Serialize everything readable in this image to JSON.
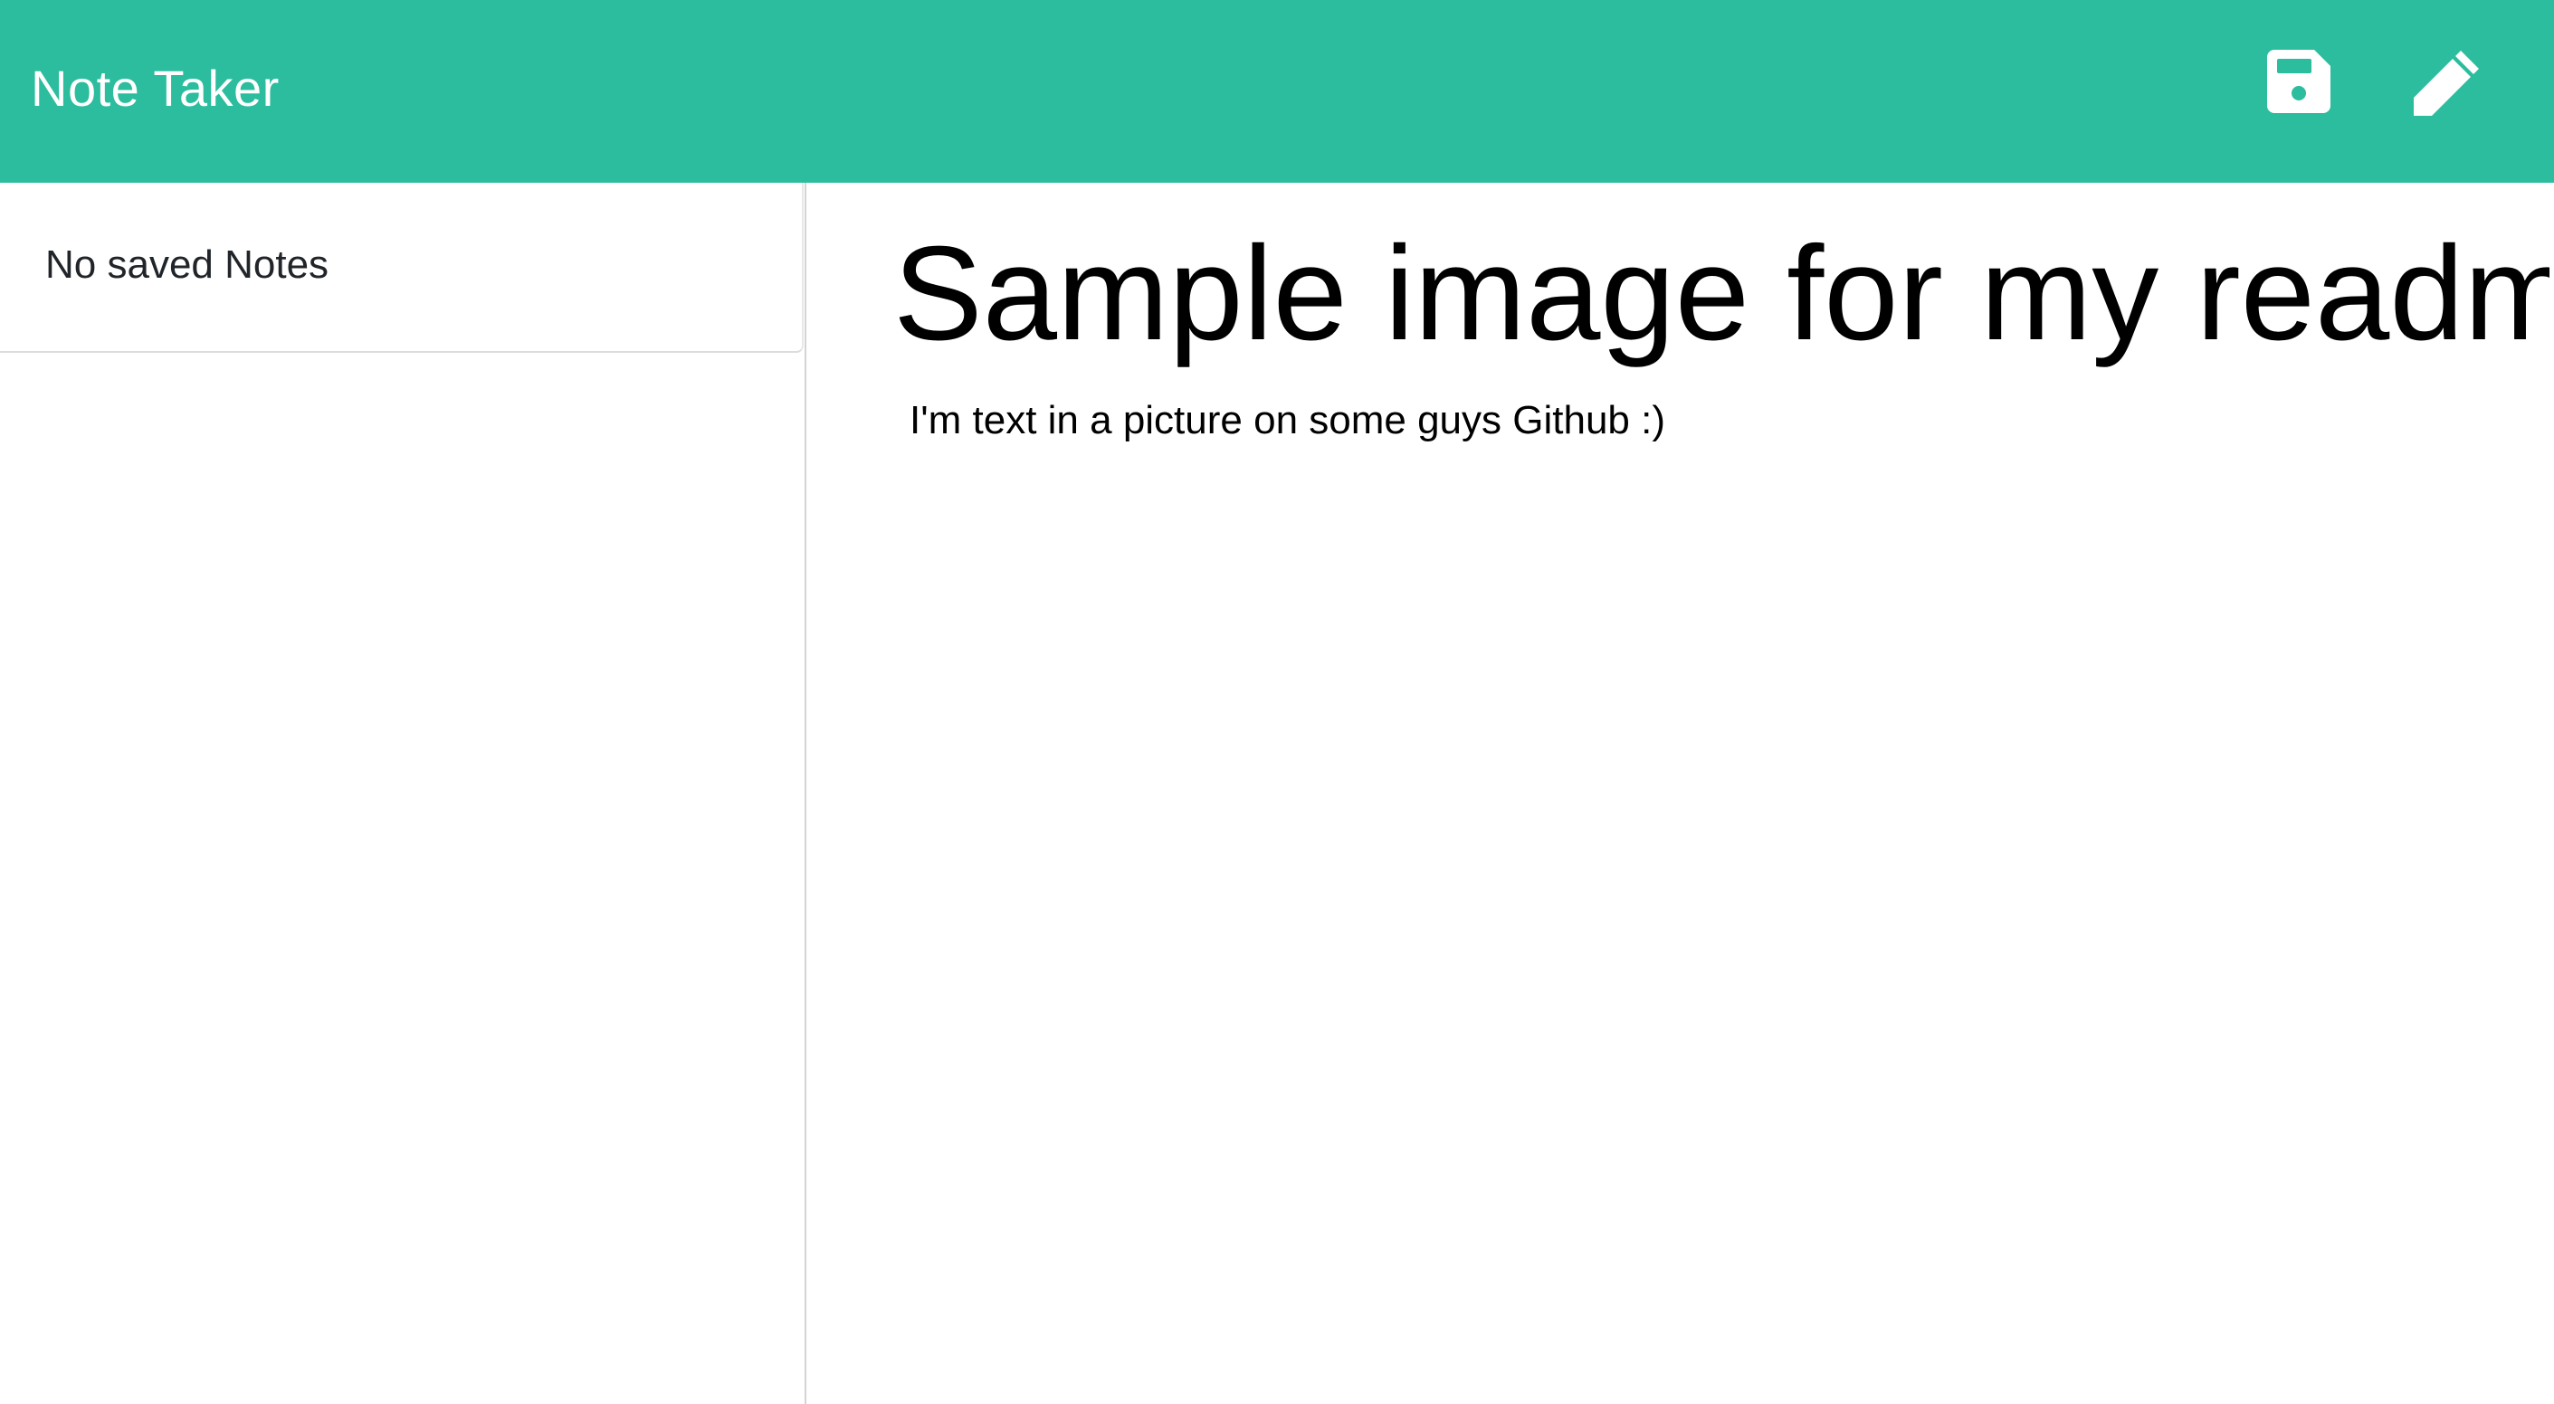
{
  "navbar": {
    "brand": "Note Taker",
    "background_color": "#2bbd9e",
    "actions": [
      {
        "icon": "save-icon"
      },
      {
        "icon": "pencil-icon"
      }
    ]
  },
  "sidebar": {
    "empty_message": "No saved Notes"
  },
  "editor": {
    "title": "Sample image for my readme",
    "body": "I'm text in a picture on some guys Github :)"
  }
}
